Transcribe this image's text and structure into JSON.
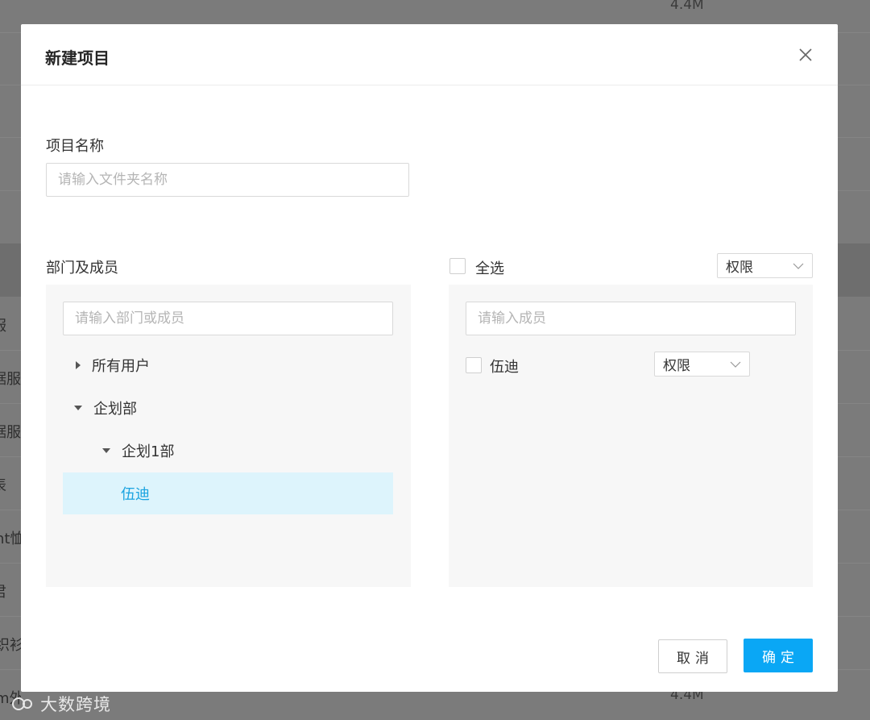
{
  "background": {
    "row_texts": [
      "服",
      "据服",
      "据服",
      "表",
      "nt恤",
      "君",
      "织衫",
      "m外"
    ],
    "file_sizes": [
      "4.4M",
      "4.4M"
    ],
    "watermark": "大数跨境"
  },
  "modal": {
    "title": "新建项目",
    "close_icon": "close-icon"
  },
  "project_name": {
    "label": "项目名称",
    "placeholder": "请输入文件夹名称"
  },
  "departments": {
    "label": "部门及成员",
    "search_placeholder": "请输入部门或成员",
    "tree": [
      {
        "label": "所有用户",
        "expanded": false,
        "level": 0
      },
      {
        "label": "企划部",
        "expanded": true,
        "level": 0
      },
      {
        "label": "企划1部",
        "expanded": true,
        "level": 1
      },
      {
        "label": "伍迪",
        "selected": true,
        "level": 2
      }
    ]
  },
  "members": {
    "select_all_label": "全选",
    "permission_label": "权限",
    "search_placeholder": "请输入成员",
    "items": [
      {
        "name": "伍迪",
        "permission": "权限",
        "checked": false
      }
    ]
  },
  "footer": {
    "cancel_label": "取消",
    "ok_label": "确定"
  },
  "colors": {
    "primary": "#0aa7f5",
    "selected_bg": "#ddf4fc",
    "selected_text": "#1aa3e0"
  }
}
